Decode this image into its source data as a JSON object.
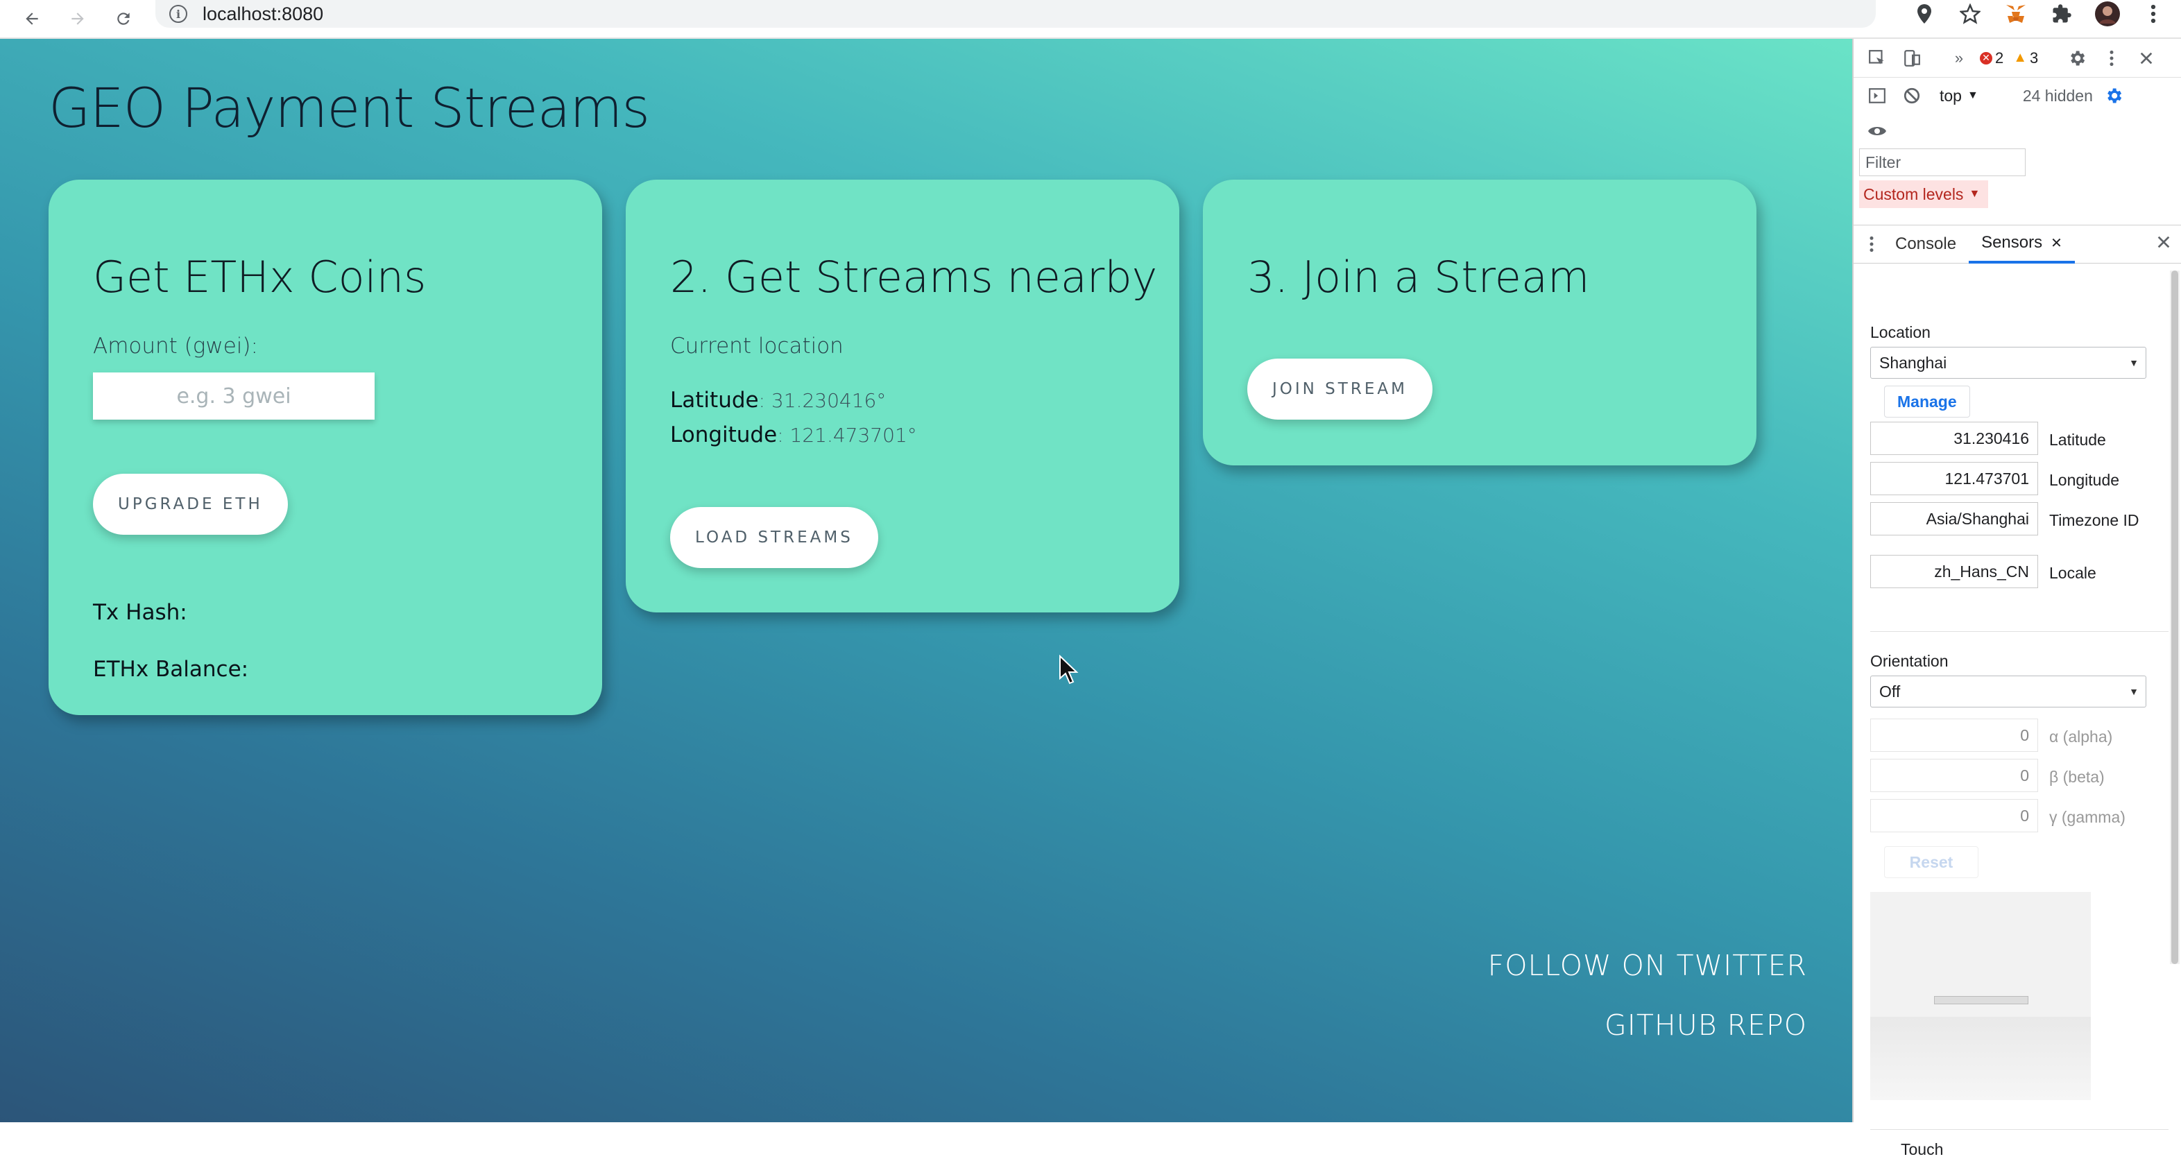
{
  "browser": {
    "url": "localhost:8080"
  },
  "page": {
    "title": "GEO Payment Streams",
    "cards": {
      "coins": {
        "title": "Get ETHx Coins",
        "amount_label": "Amount (gwei):",
        "amount_placeholder": "e.g. 3 gwei",
        "amount_value": "",
        "upgrade_button": "UPGRADE ETH",
        "tx_hash_label": "Tx Hash:",
        "balance_label": "ETHx Balance:"
      },
      "streams": {
        "title": "2. Get Streams nearby",
        "location_label": "Current location",
        "latitude_label": "Latitude",
        "latitude_value": ": 31.230416°",
        "longitude_label": "Longitude",
        "longitude_value": ": 121.473701°",
        "load_button": "LOAD STREAMS"
      },
      "join": {
        "title": "3. Join a Stream",
        "join_button": "JOIN STREAM"
      }
    },
    "footer": {
      "twitter": "FOLLOW ON TWITTER",
      "github": "GITHUB REPO"
    }
  },
  "devtools": {
    "error_count": "2",
    "warning_count": "3",
    "context": "top",
    "hidden": "24 hidden",
    "filter_placeholder": "Filter",
    "levels": "Custom levels",
    "tabs": [
      "Console",
      "Sensors"
    ],
    "sensors": {
      "location_label": "Location",
      "location_value": "Shanghai",
      "manage_button": "Manage",
      "latitude": "31.230416",
      "latitude_label": "Latitude",
      "longitude": "121.473701",
      "longitude_label": "Longitude",
      "timezone": "Asia/Shanghai",
      "timezone_label": "Timezone ID",
      "locale": "zh_Hans_CN",
      "locale_label": "Locale",
      "orientation_label": "Orientation",
      "orientation_value": "Off",
      "alpha": "0",
      "alpha_label": "α (alpha)",
      "beta": "0",
      "beta_label": "β (beta)",
      "gamma": "0",
      "gamma_label": "γ (gamma)",
      "reset_button": "Reset",
      "touch_label": "Touch"
    }
  }
}
